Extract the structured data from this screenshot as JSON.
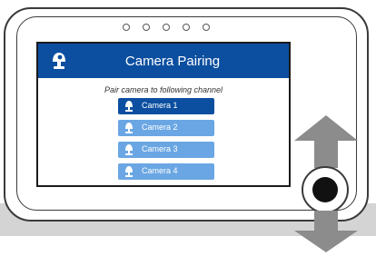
{
  "screen": {
    "title": "Camera Pairing",
    "subtitle": "Pair camera to following channel",
    "header_icon": "camera-icon"
  },
  "channels": [
    {
      "label": "Camera 1",
      "state": "selected"
    },
    {
      "label": "Camera 2",
      "state": "unselected"
    },
    {
      "label": "Camera 3",
      "state": "unselected"
    },
    {
      "label": "Camera 4",
      "state": "unselected"
    }
  ],
  "indicators": {
    "count": 5
  },
  "colors": {
    "header_blue": "#0c4fa0",
    "selected_button": "#0c4fa0",
    "unselected_button": "#6aa6e3",
    "arrow_gray": "#8c8c8c",
    "floor_gray": "#d4d4d4"
  },
  "annotations": {
    "up_arrow_icon": "up-arrow-icon",
    "down_arrow_icon": "down-arrow-icon"
  }
}
